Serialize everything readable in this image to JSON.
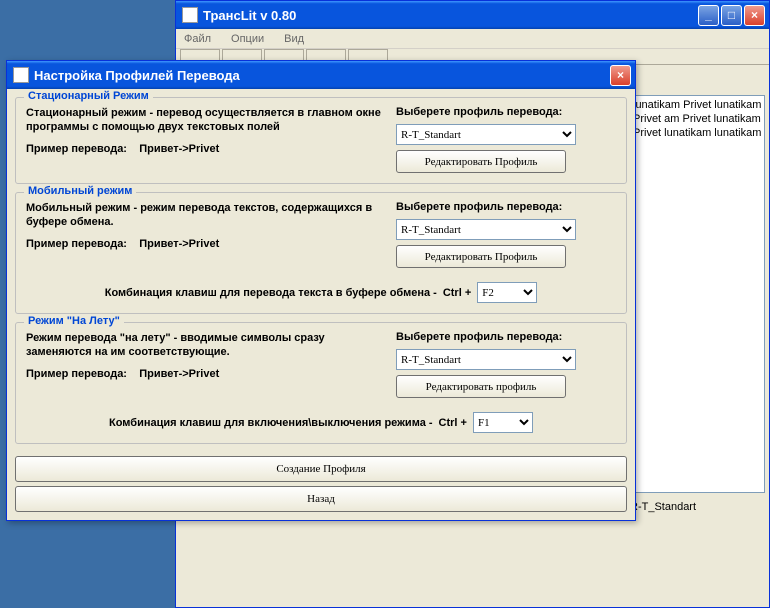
{
  "mainWindow": {
    "title": "ТрансLit v 0.80",
    "menu": {
      "file": "Файл",
      "options": "Опции",
      "view": "Вид"
    },
    "textarea": "lunatikam Privet lunatikam Privet am Privet lunatikam Privet lunatikam lunatikam",
    "status": "R-T_Standart"
  },
  "dialog": {
    "title": "Настройка Профилей Перевода",
    "groups": {
      "stationary": {
        "title": "Стационарный Режим",
        "desc": "Стационарный режим - перевод осуществляется в главном окне программы с помощью двух текстовых полей",
        "exampleLabel": "Пример перевода:",
        "exampleValue": "Привет->Privet",
        "profileLabel": "Выберете профиль перевода:",
        "profileValue": "R-T_Standart",
        "editBtn": "Редактировать Профиль"
      },
      "mobile": {
        "title": "Мобильный режим",
        "desc": "Мобильный режим - режим перевода текстов, содержащихся в буфере обмена.",
        "exampleLabel": "Пример перевода:",
        "exampleValue": "Привет->Privet",
        "profileLabel": "Выберете профиль перевода:",
        "profileValue": "R-T_Standart",
        "editBtn": "Редактировать Профиль",
        "hotkeyLabel": "Комбинация клавиш для перевода текста в буфере обмена -",
        "hotkeyPrefix": "Ctrl +",
        "hotkeyValue": "F2"
      },
      "fly": {
        "title": "Режим \"На Лету\"",
        "desc": "Режим перевода \"на лету\" - вводимые символы сразу заменяются на им соответствующие.",
        "exampleLabel": "Пример перевода:",
        "exampleValue": "Привет->Privet",
        "profileLabel": "Выберете профиль перевода:",
        "profileValue": "R-T_Standart",
        "editBtn": "Редактировать профиль",
        "hotkeyLabel": "Комбинация клавиш для включения\\выключения режима -",
        "hotkeyPrefix": "Ctrl +",
        "hotkeyValue": "F1"
      }
    },
    "createBtn": "Создание Профиля",
    "backBtn": "Назад"
  }
}
